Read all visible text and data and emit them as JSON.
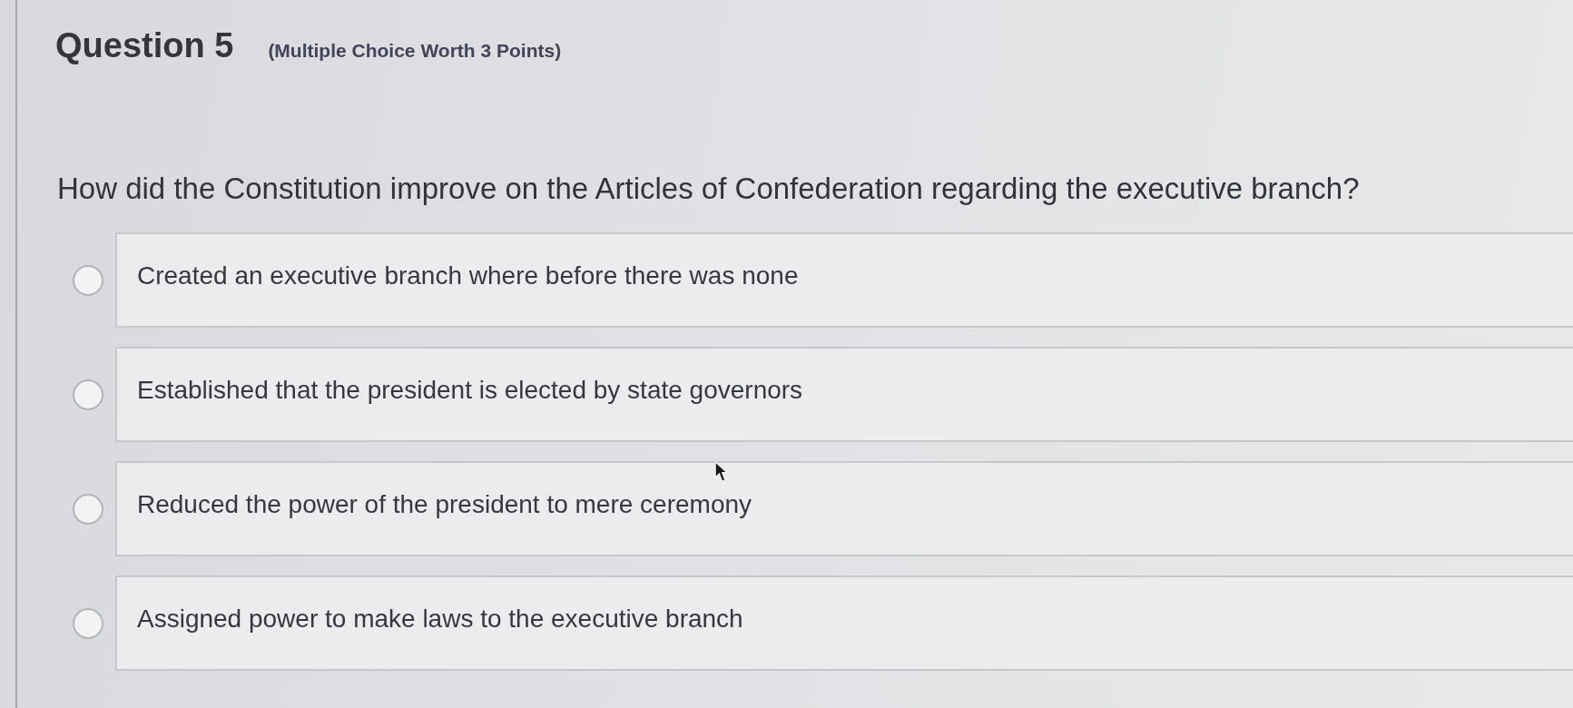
{
  "question": {
    "number_label": "Question 5",
    "meta": "(Multiple Choice Worth 3 Points)",
    "text": "How did the Constitution improve on the Articles of Confederation regarding the executive branch?"
  },
  "options": [
    {
      "label": "Created an executive branch where before there was none",
      "selected": false
    },
    {
      "label": "Established that the president is elected by state governors",
      "selected": false
    },
    {
      "label": "Reduced the power of the president to mere ceremony",
      "selected": false
    },
    {
      "label": "Assigned power to make laws to the executive branch",
      "selected": false
    }
  ]
}
